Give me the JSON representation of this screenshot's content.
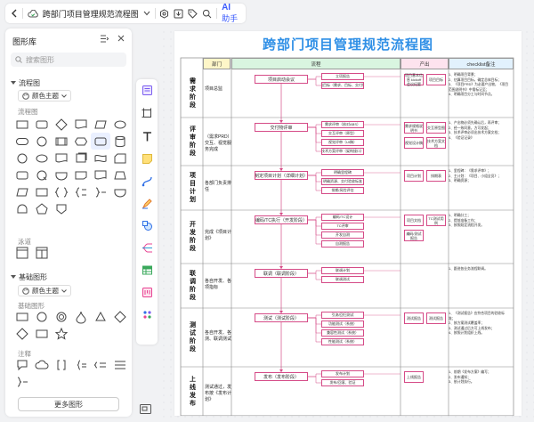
{
  "topbar": {
    "doc_title": "跨部门项目管理规范流程图",
    "ai_label": "AI",
    "ai_helper": "助手",
    "icons": [
      "back-icon",
      "cloud-icon",
      "chevron-down-icon",
      "settings-icon",
      "download-icon",
      "tag-icon",
      "search-icon"
    ]
  },
  "library": {
    "title": "图形库",
    "search_placeholder": "搜索图形",
    "section_flowchart": "流程图",
    "theme_label": "颜色主题",
    "sub_flowchart": "流程图",
    "sub_lane": "泳道",
    "section_basic": "基础图形",
    "sub_basic": "基础图形",
    "sub_annotation": "注释",
    "more_button": "更多图形"
  },
  "diagram": {
    "title": "跨部门项目管理规范流程图",
    "headers": [
      "部门",
      "流程",
      "产出",
      "checklist备注"
    ],
    "header_colors": [
      "#fef6c8",
      "#d9f5e0",
      "#fde3ee",
      "#e2f1fd"
    ],
    "phases": [
      {
        "name": "需求阶段",
        "dept": "项目总监",
        "boxes": [
          "项目启动会议",
          "立项报告",
          "项目目标（需求、目标、交付物）"
        ],
        "docs": [
          "项目基本信息 kickoff会议纪要",
          "项目目标"
        ],
        "notes": [
          "1、明确项目背景；",
          "2、估算项目目标，确定总体目标；",
          "3、《项目PRD》为必要产出物，《项目范围说明书》中需标记至；",
          "4、明确项目分工与时间节点。"
        ]
      },
      {
        "name": "评审阶段",
        "dept": "（需求PRD）交互、视觉服务完成",
        "boxes": [
          "交付物评审",
          "需求评审（核对ABS）",
          "交互评审（原型）",
          "视觉评审（UI稿）",
          "技术方案评审（架构接口）"
        ],
        "docs": [
          "需求规格说明书",
          "交互原型图",
          "视觉设计稿",
          "技术方案文档"
        ],
        "notes": [
          "1、产出物必须先确认后，再评审；",
          "2、经一致同意，方可发起；",
          "3、技术评审必须出技术方案文档；",
          "4、《验证记录》"
        ]
      },
      {
        "name": "项目计划",
        "dept": "各部门负责排任",
        "boxes": [
          "制定项目计划（详细计划）",
          "明确里程碑",
          "明确资源、交付验收标准",
          "排期/风险评估"
        ],
        "docs": [
          "项目计划",
          "排期表"
        ],
        "notes": [
          "1、里程碑：《需求评审》；",
          "2、主计划：《项目、小组全员》；",
          "3、明确资源；"
        ]
      },
      {
        "name": "开发阶段",
        "dept": "完成《项目计划》",
        "boxes": [
          "编码/TC执行（开发阶段）",
          "编码/TC设计",
          "TC评审",
          "开发自测",
          "自测报告"
        ],
        "docs": [
          "项目文档",
          "TC测试用例",
          "编码/测试报告"
        ],
        "notes": [
          "1、明确分工；",
          "2、提前准备工作；",
          "3、按照既定流程开发。"
        ]
      },
      {
        "name": "联调阶段",
        "dept": "各自开发、各项指标",
        "boxes": [
          "联调（联调阶段）",
          "联调计划",
          "联调测试"
        ],
        "docs": [],
        "notes": [
          "1、跟进各业务流程联调。"
        ]
      },
      {
        "name": "测试阶段",
        "dept": "各自开发、各测、联调测试",
        "boxes": [
          "测试（测试阶段）",
          "引流/回归测试",
          "功能测试（系统）",
          "兼容性测试（系统）",
          "性能测试（系统）"
        ],
        "docs": [
          "测试报告",
          "测试报告"
        ],
        "notes": [
          "1、《测试报告》应符合项目的验收标准；",
          "2、按方案测试覆盖率；",
          "3、测试通过后方可上线发布；",
          "4、按照计划组织上线。"
        ]
      },
      {
        "name": "上线发布",
        "dept": "测试通过，发布按《发布计划》",
        "boxes": [
          "发布（发布阶段）",
          "发布计划",
          "发布/回滚、验证"
        ],
        "docs": [
          "上线报告"
        ],
        "notes": [
          "1、前期《发布方案》编写；",
          "2、发布通知；",
          "3、依计划执行。"
        ]
      }
    ]
  }
}
